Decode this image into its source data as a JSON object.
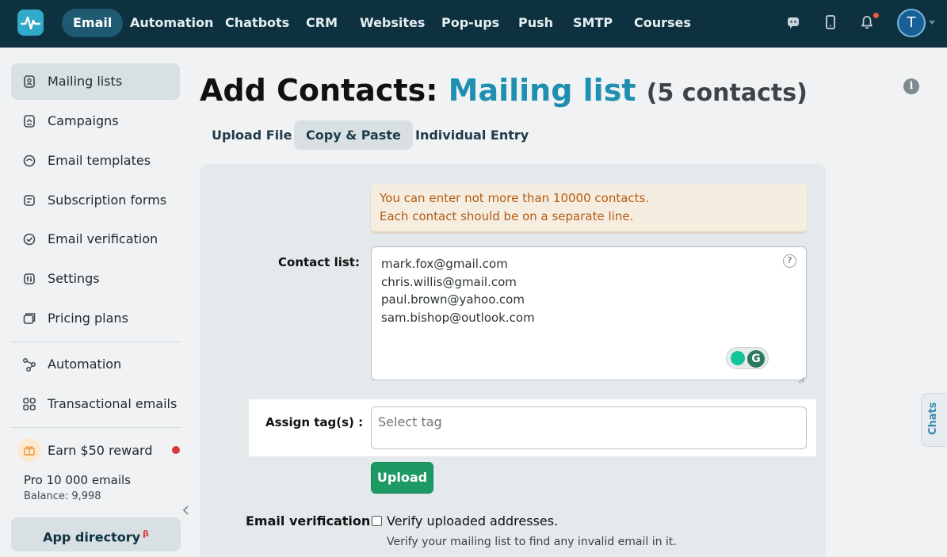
{
  "topnav": {
    "logo_icon": "pulse-logo-icon",
    "items": [
      "Email",
      "Automation",
      "Chatbots",
      "CRM",
      "Websites",
      "Pop-ups",
      "Push",
      "SMTP",
      "Courses"
    ],
    "active_item": "Email",
    "icons": [
      "chat-icon",
      "mobile-icon",
      "bell-icon"
    ],
    "avatar_letter": "T"
  },
  "sidebar": {
    "items": [
      {
        "label": "Mailing lists",
        "icon": "contacts-book-icon"
      },
      {
        "label": "Campaigns",
        "icon": "campaign-icon"
      },
      {
        "label": "Email templates",
        "icon": "template-icon"
      },
      {
        "label": "Subscription forms",
        "icon": "form-icon"
      },
      {
        "label": "Email verification",
        "icon": "verify-check-icon"
      },
      {
        "label": "Settings",
        "icon": "settings-sliders-icon"
      },
      {
        "label": "Pricing plans",
        "icon": "pricing-card-icon"
      },
      {
        "label": "Automation",
        "icon": "automation-flow-icon"
      },
      {
        "label": "Transactional emails",
        "icon": "grid-icon"
      }
    ],
    "reward": {
      "label": "Earn $50 reward",
      "icon": "gift-icon"
    },
    "plan": {
      "name": "Pro 10 000 emails",
      "balance": "Balance: 9,998"
    },
    "app_directory": {
      "label": "App directory",
      "badge": "β"
    }
  },
  "page": {
    "title_prefix": "Add Contacts:",
    "list_name": "Mailing list",
    "contacts_count": "(5 contacts)"
  },
  "tabs": [
    "Upload File",
    "Copy & Paste",
    "Individual Entry"
  ],
  "active_tab": "Copy & Paste",
  "form": {
    "alert_line1": "You can enter not more than 10000 contacts.",
    "alert_line2": "Each contact should be on a separate line.",
    "contact_list_label": "Contact list:",
    "contacts": [
      "mark.fox@gmail.com",
      "chris.willis@gmail.com",
      "paul.brown@yahoo.com",
      "sam.bishop@outlook.com"
    ],
    "tag_label": "Assign tag(s) :",
    "tag_placeholder": "Select tag",
    "upload_label": "Upload",
    "verification_label": "Email verification:",
    "verify_checkbox_label": "Verify uploaded addresses.",
    "verify_checked": false,
    "verify_hint": "Verify your mailing list to find any invalid email in it."
  },
  "chats_tab": "Chats",
  "colors": {
    "topbar": "#0e3140",
    "accent": "#1e8fb0",
    "upload_button": "#1d9964",
    "alert_text": "#b35b13"
  }
}
